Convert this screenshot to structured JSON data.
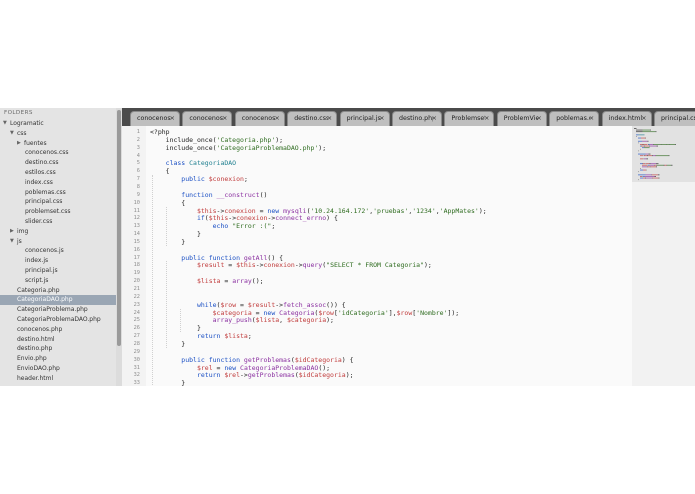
{
  "sidebar": {
    "title": "FOLDERS",
    "items": [
      {
        "label": "Logramatic",
        "depth": 0,
        "arrow": "down"
      },
      {
        "label": "css",
        "depth": 1,
        "arrow": "down"
      },
      {
        "label": "fuentes",
        "depth": 2,
        "arrow": "right"
      },
      {
        "label": "conocenos.css",
        "depth": 3
      },
      {
        "label": "destino.css",
        "depth": 3
      },
      {
        "label": "estilos.css",
        "depth": 3
      },
      {
        "label": "index.css",
        "depth": 3
      },
      {
        "label": "poblemas.css",
        "depth": 3
      },
      {
        "label": "principal.css",
        "depth": 3
      },
      {
        "label": "problemset.css",
        "depth": 3
      },
      {
        "label": "slider.css",
        "depth": 3
      },
      {
        "label": "img",
        "depth": 1,
        "arrow": "right"
      },
      {
        "label": "js",
        "depth": 1,
        "arrow": "down"
      },
      {
        "label": "conocenos.js",
        "depth": 3
      },
      {
        "label": "index.js",
        "depth": 3
      },
      {
        "label": "principal.js",
        "depth": 3
      },
      {
        "label": "script.js",
        "depth": 3
      },
      {
        "label": "Categoria.php",
        "depth": 1
      },
      {
        "label": "CategoriaDAO.php",
        "depth": 1,
        "selected": true
      },
      {
        "label": "CategoriaProblema.php",
        "depth": 1
      },
      {
        "label": "CategoriaProblemaDAO.php",
        "depth": 1
      },
      {
        "label": "conocenos.php",
        "depth": 1
      },
      {
        "label": "destino.html",
        "depth": 1
      },
      {
        "label": "destino.php",
        "depth": 1
      },
      {
        "label": "Envio.php",
        "depth": 1
      },
      {
        "label": "EnvioDAO.php",
        "depth": 1
      },
      {
        "label": "header.html",
        "depth": 1
      }
    ]
  },
  "tabs": [
    {
      "label": "conocenos.p",
      "close": "×"
    },
    {
      "label": "conocenos.c",
      "close": "×"
    },
    {
      "label": "conocenos.js",
      "close": "×"
    },
    {
      "label": "destino.css",
      "close": "×"
    },
    {
      "label": "principal.js",
      "close": "×"
    },
    {
      "label": "destino.php",
      "close": "×"
    },
    {
      "label": "Problemset.p",
      "close": "×"
    },
    {
      "label": "ProblemView",
      "close": "×"
    },
    {
      "label": "poblemas.css",
      "close": "×"
    },
    {
      "label": "index.html",
      "close": "×"
    },
    {
      "label": "principal.css",
      "close": "×"
    }
  ],
  "colors": {
    "keyword": "#1a4fc4",
    "string": "#2d6b1e",
    "variable": "#c03a3a",
    "function": "#8a2fa0",
    "plain": "#222222",
    "classname": "#1e7f8f"
  },
  "code": [
    {
      "n": "1",
      "t": [
        [
          "<?php",
          "plain"
        ]
      ]
    },
    {
      "n": "2",
      "t": [
        [
          "    include_once(",
          "plain"
        ],
        [
          "'Categoria.php'",
          "string"
        ],
        [
          ");",
          "plain"
        ]
      ]
    },
    {
      "n": "3",
      "t": [
        [
          "    include_once(",
          "plain"
        ],
        [
          "'CategoriaProblemaDAO.php'",
          "string"
        ],
        [
          ");",
          "plain"
        ]
      ]
    },
    {
      "n": "4",
      "t": []
    },
    {
      "n": "5",
      "t": [
        [
          "    class ",
          "keyword"
        ],
        [
          "CategoriaDAO",
          "classname"
        ]
      ]
    },
    {
      "n": "6",
      "t": [
        [
          "    {",
          "plain"
        ]
      ]
    },
    {
      "n": "7",
      "t": [
        [
          "        public ",
          "keyword"
        ],
        [
          "$conexion",
          "variable"
        ],
        [
          ";",
          "plain"
        ]
      ]
    },
    {
      "n": "8",
      "t": []
    },
    {
      "n": "9",
      "t": [
        [
          "        function ",
          "keyword"
        ],
        [
          "__construct",
          "function"
        ],
        [
          "()",
          "plain"
        ]
      ]
    },
    {
      "n": "10",
      "t": [
        [
          "        {",
          "plain"
        ]
      ]
    },
    {
      "n": "11",
      "t": [
        [
          "            $this",
          "variable"
        ],
        [
          "->",
          "plain"
        ],
        [
          "conexion",
          "variable"
        ],
        [
          " = ",
          "plain"
        ],
        [
          "new ",
          "keyword"
        ],
        [
          "mysqli",
          "function"
        ],
        [
          "(",
          "plain"
        ],
        [
          "'10.24.164.172'",
          "string"
        ],
        [
          ",",
          "plain"
        ],
        [
          "'pruebas'",
          "string"
        ],
        [
          ",",
          "plain"
        ],
        [
          "'1234'",
          "string"
        ],
        [
          ",",
          "plain"
        ],
        [
          "'AppMates'",
          "string"
        ],
        [
          ");",
          "plain"
        ]
      ]
    },
    {
      "n": "12",
      "t": [
        [
          "            if",
          "keyword"
        ],
        [
          "(",
          "plain"
        ],
        [
          "$this",
          "variable"
        ],
        [
          "->",
          "plain"
        ],
        [
          "conexion",
          "variable"
        ],
        [
          "->",
          "plain"
        ],
        [
          "connect_errno",
          "function"
        ],
        [
          ") {",
          "plain"
        ]
      ]
    },
    {
      "n": "13",
      "t": [
        [
          "                echo ",
          "keyword"
        ],
        [
          "\"Error :(\"",
          "string"
        ],
        [
          ";",
          "plain"
        ]
      ]
    },
    {
      "n": "14",
      "t": [
        [
          "            }",
          "plain"
        ]
      ]
    },
    {
      "n": "15",
      "t": [
        [
          "        }",
          "plain"
        ]
      ]
    },
    {
      "n": "16",
      "t": []
    },
    {
      "n": "17",
      "t": [
        [
          "        public function ",
          "keyword"
        ],
        [
          "getAll",
          "function"
        ],
        [
          "() {",
          "plain"
        ]
      ]
    },
    {
      "n": "18",
      "t": [
        [
          "            $result",
          "variable"
        ],
        [
          " = ",
          "plain"
        ],
        [
          "$this",
          "variable"
        ],
        [
          "->",
          "plain"
        ],
        [
          "conexion",
          "variable"
        ],
        [
          "->",
          "plain"
        ],
        [
          "query",
          "function"
        ],
        [
          "(",
          "plain"
        ],
        [
          "\"SELECT * FROM Categoria\"",
          "string"
        ],
        [
          ");",
          "plain"
        ]
      ]
    },
    {
      "n": "19",
      "t": []
    },
    {
      "n": "20",
      "t": [
        [
          "            $lista",
          "variable"
        ],
        [
          " = ",
          "plain"
        ],
        [
          "array",
          "function"
        ],
        [
          "();",
          "plain"
        ]
      ]
    },
    {
      "n": "21",
      "t": []
    },
    {
      "n": "22",
      "t": []
    },
    {
      "n": "23",
      "t": [
        [
          "            while",
          "keyword"
        ],
        [
          "(",
          "plain"
        ],
        [
          "$row",
          "variable"
        ],
        [
          " = ",
          "plain"
        ],
        [
          "$result",
          "variable"
        ],
        [
          "->",
          "plain"
        ],
        [
          "fetch_assoc",
          "function"
        ],
        [
          "()) {",
          "plain"
        ]
      ]
    },
    {
      "n": "24",
      "t": [
        [
          "                $categoria",
          "variable"
        ],
        [
          " = ",
          "plain"
        ],
        [
          "new ",
          "keyword"
        ],
        [
          "Categoria",
          "function"
        ],
        [
          "(",
          "plain"
        ],
        [
          "$row",
          "variable"
        ],
        [
          "[",
          "plain"
        ],
        [
          "'idCategoria'",
          "string"
        ],
        [
          "],",
          "plain"
        ],
        [
          "$row",
          "variable"
        ],
        [
          "[",
          "plain"
        ],
        [
          "'Nombre'",
          "string"
        ],
        [
          "]);",
          "plain"
        ]
      ]
    },
    {
      "n": "25",
      "t": [
        [
          "                array_push",
          "function"
        ],
        [
          "(",
          "plain"
        ],
        [
          "$lista",
          "variable"
        ],
        [
          ", ",
          "plain"
        ],
        [
          "$categoria",
          "variable"
        ],
        [
          ");",
          "plain"
        ]
      ]
    },
    {
      "n": "26",
      "t": [
        [
          "            }",
          "plain"
        ]
      ]
    },
    {
      "n": "27",
      "t": [
        [
          "            return ",
          "keyword"
        ],
        [
          "$lista",
          "variable"
        ],
        [
          ";",
          "plain"
        ]
      ]
    },
    {
      "n": "28",
      "t": [
        [
          "        }",
          "plain"
        ]
      ]
    },
    {
      "n": "29",
      "t": []
    },
    {
      "n": "30",
      "t": [
        [
          "        public function ",
          "keyword"
        ],
        [
          "getProblemas",
          "function"
        ],
        [
          "(",
          "plain"
        ],
        [
          "$idCategoria",
          "variable"
        ],
        [
          ") {",
          "plain"
        ]
      ]
    },
    {
      "n": "31",
      "t": [
        [
          "            $rel",
          "variable"
        ],
        [
          " = ",
          "plain"
        ],
        [
          "new ",
          "keyword"
        ],
        [
          "CategoriaProblemaDAO",
          "function"
        ],
        [
          "();",
          "plain"
        ]
      ]
    },
    {
      "n": "32",
      "t": [
        [
          "            return ",
          "keyword"
        ],
        [
          "$rel",
          "variable"
        ],
        [
          "->",
          "plain"
        ],
        [
          "getProblemas",
          "function"
        ],
        [
          "(",
          "plain"
        ],
        [
          "$idCategoria",
          "variable"
        ],
        [
          ");",
          "plain"
        ]
      ]
    },
    {
      "n": "33",
      "t": [
        [
          "        }",
          "plain"
        ]
      ]
    }
  ]
}
